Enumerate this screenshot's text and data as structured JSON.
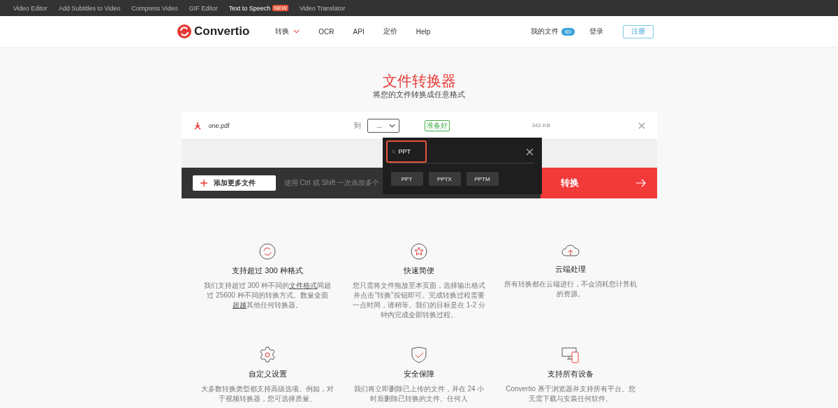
{
  "topbar": {
    "links": [
      {
        "label": "Video Editor",
        "highlight": false
      },
      {
        "label": "Add Subtitles to Video",
        "highlight": false
      },
      {
        "label": "Compress Video",
        "highlight": false
      },
      {
        "label": "GIF Editor",
        "highlight": false
      },
      {
        "label": "Text to Speech",
        "highlight": true,
        "badge": "NEW"
      },
      {
        "label": "Video Translator",
        "highlight": false
      }
    ]
  },
  "header": {
    "logo": "Convertio",
    "nav": [
      {
        "label": "转换",
        "dropdown": true
      },
      {
        "label": "OCR",
        "dropdown": false
      },
      {
        "label": "API",
        "dropdown": false
      },
      {
        "label": "定价",
        "dropdown": false
      },
      {
        "label": "Help",
        "dropdown": false
      }
    ],
    "my_files": "我的文件",
    "files_count": "60",
    "login": "登录",
    "signup": "注册"
  },
  "hero": {
    "title": "文件转换器",
    "subtitle": "将您的文件转换成任意格式"
  },
  "file": {
    "name": "one.pdf",
    "to_label": "到",
    "format_value": "...",
    "status": "准备好",
    "size": "342 KB"
  },
  "action_bar": {
    "add_button": "添加更多文件",
    "hint": "使用 Ctrl 或 Shift 一次添加多个",
    "convert_button": "转换"
  },
  "format_dropdown": {
    "search_value": "PPT",
    "options": [
      {
        "label": "PPT"
      },
      {
        "label": "PPTX"
      },
      {
        "label": "PPTM"
      }
    ]
  },
  "features": [
    {
      "kind": "refresh",
      "title": "支持超过 300 种格式",
      "desc": [
        {
          "text": "我们支持超过 300 种不同的",
          "link": false
        },
        {
          "text": "文件格式",
          "link": true
        },
        {
          "text": "间超过 25600 种不同的转换方式。数量全面",
          "link": false
        },
        {
          "text": "超越",
          "link": true
        },
        {
          "text": "其他任何转换器。",
          "link": false
        }
      ]
    },
    {
      "kind": "star",
      "title": "快速简便",
      "desc": [
        {
          "text": "您只需将文件拖放至本页面，选择输出格式并点击\"转换\"按钮即可。完成转换过程需要一点时间，请稍等。我们的目标是在 1-2 分钟内完成全部转换过程。",
          "link": false
        }
      ]
    },
    {
      "kind": "cloud",
      "title": "云端处理",
      "desc": [
        {
          "text": "所有转换都在云端进行，不会消耗您计算机的资源。",
          "link": false
        }
      ]
    },
    {
      "kind": "gear",
      "title": "自定义设置",
      "desc": [
        {
          "text": "大多数转换类型都支持高级选项。例如，对于视频转换器，您可选择质量、",
          "link": false
        }
      ]
    },
    {
      "kind": "shield",
      "title": "安全保障",
      "desc": [
        {
          "text": "我们将立即删除已上传的文件，并在 24 小时后删除已转换的文件。任何人",
          "link": false
        }
      ]
    },
    {
      "kind": "devices",
      "title": "支持所有设备",
      "desc": [
        {
          "text": "Convertio 基于浏览器并支持所有平台。您无需下载与安装任何软件。",
          "link": false
        }
      ]
    }
  ]
}
